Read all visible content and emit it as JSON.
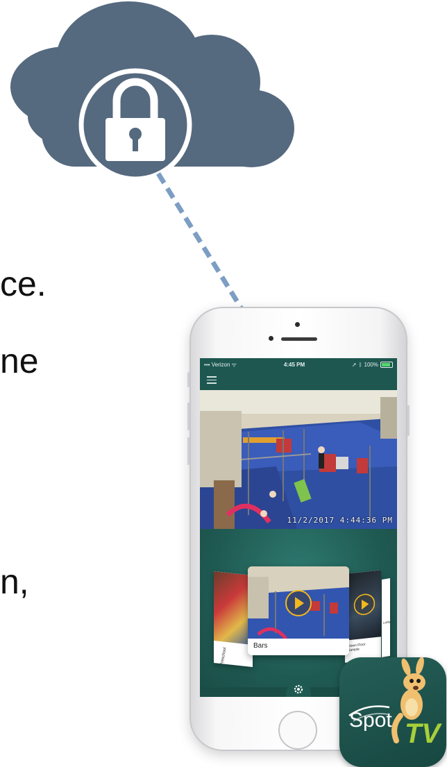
{
  "slide_text_lines": [
    "ce.",
    "ne",
    "n,"
  ],
  "phone": {
    "status_bar": {
      "carrier": "Verizon",
      "time": "4:45 PM",
      "battery": "100%"
    },
    "camera_timestamp": "11/2/2017 4:44:36 PM",
    "cards": {
      "left_label": "Preschool",
      "main_label": "Bars",
      "right_label": "Down Floor Sample",
      "edge_label": "Lobby"
    }
  },
  "app_icon": {
    "brand": "Spot",
    "brand_suffix": "TV"
  },
  "colors": {
    "cloud": "#55697f",
    "connector": "#7d9ec3",
    "app_teal": "#1f5a52",
    "play_accent": "#f2b81d",
    "tv_green": "#a7cf3a"
  },
  "icons": [
    "cloud-icon",
    "lock-icon",
    "menu-icon",
    "wifi-icon",
    "play-icon",
    "gear-icon",
    "kangaroo-icon"
  ]
}
